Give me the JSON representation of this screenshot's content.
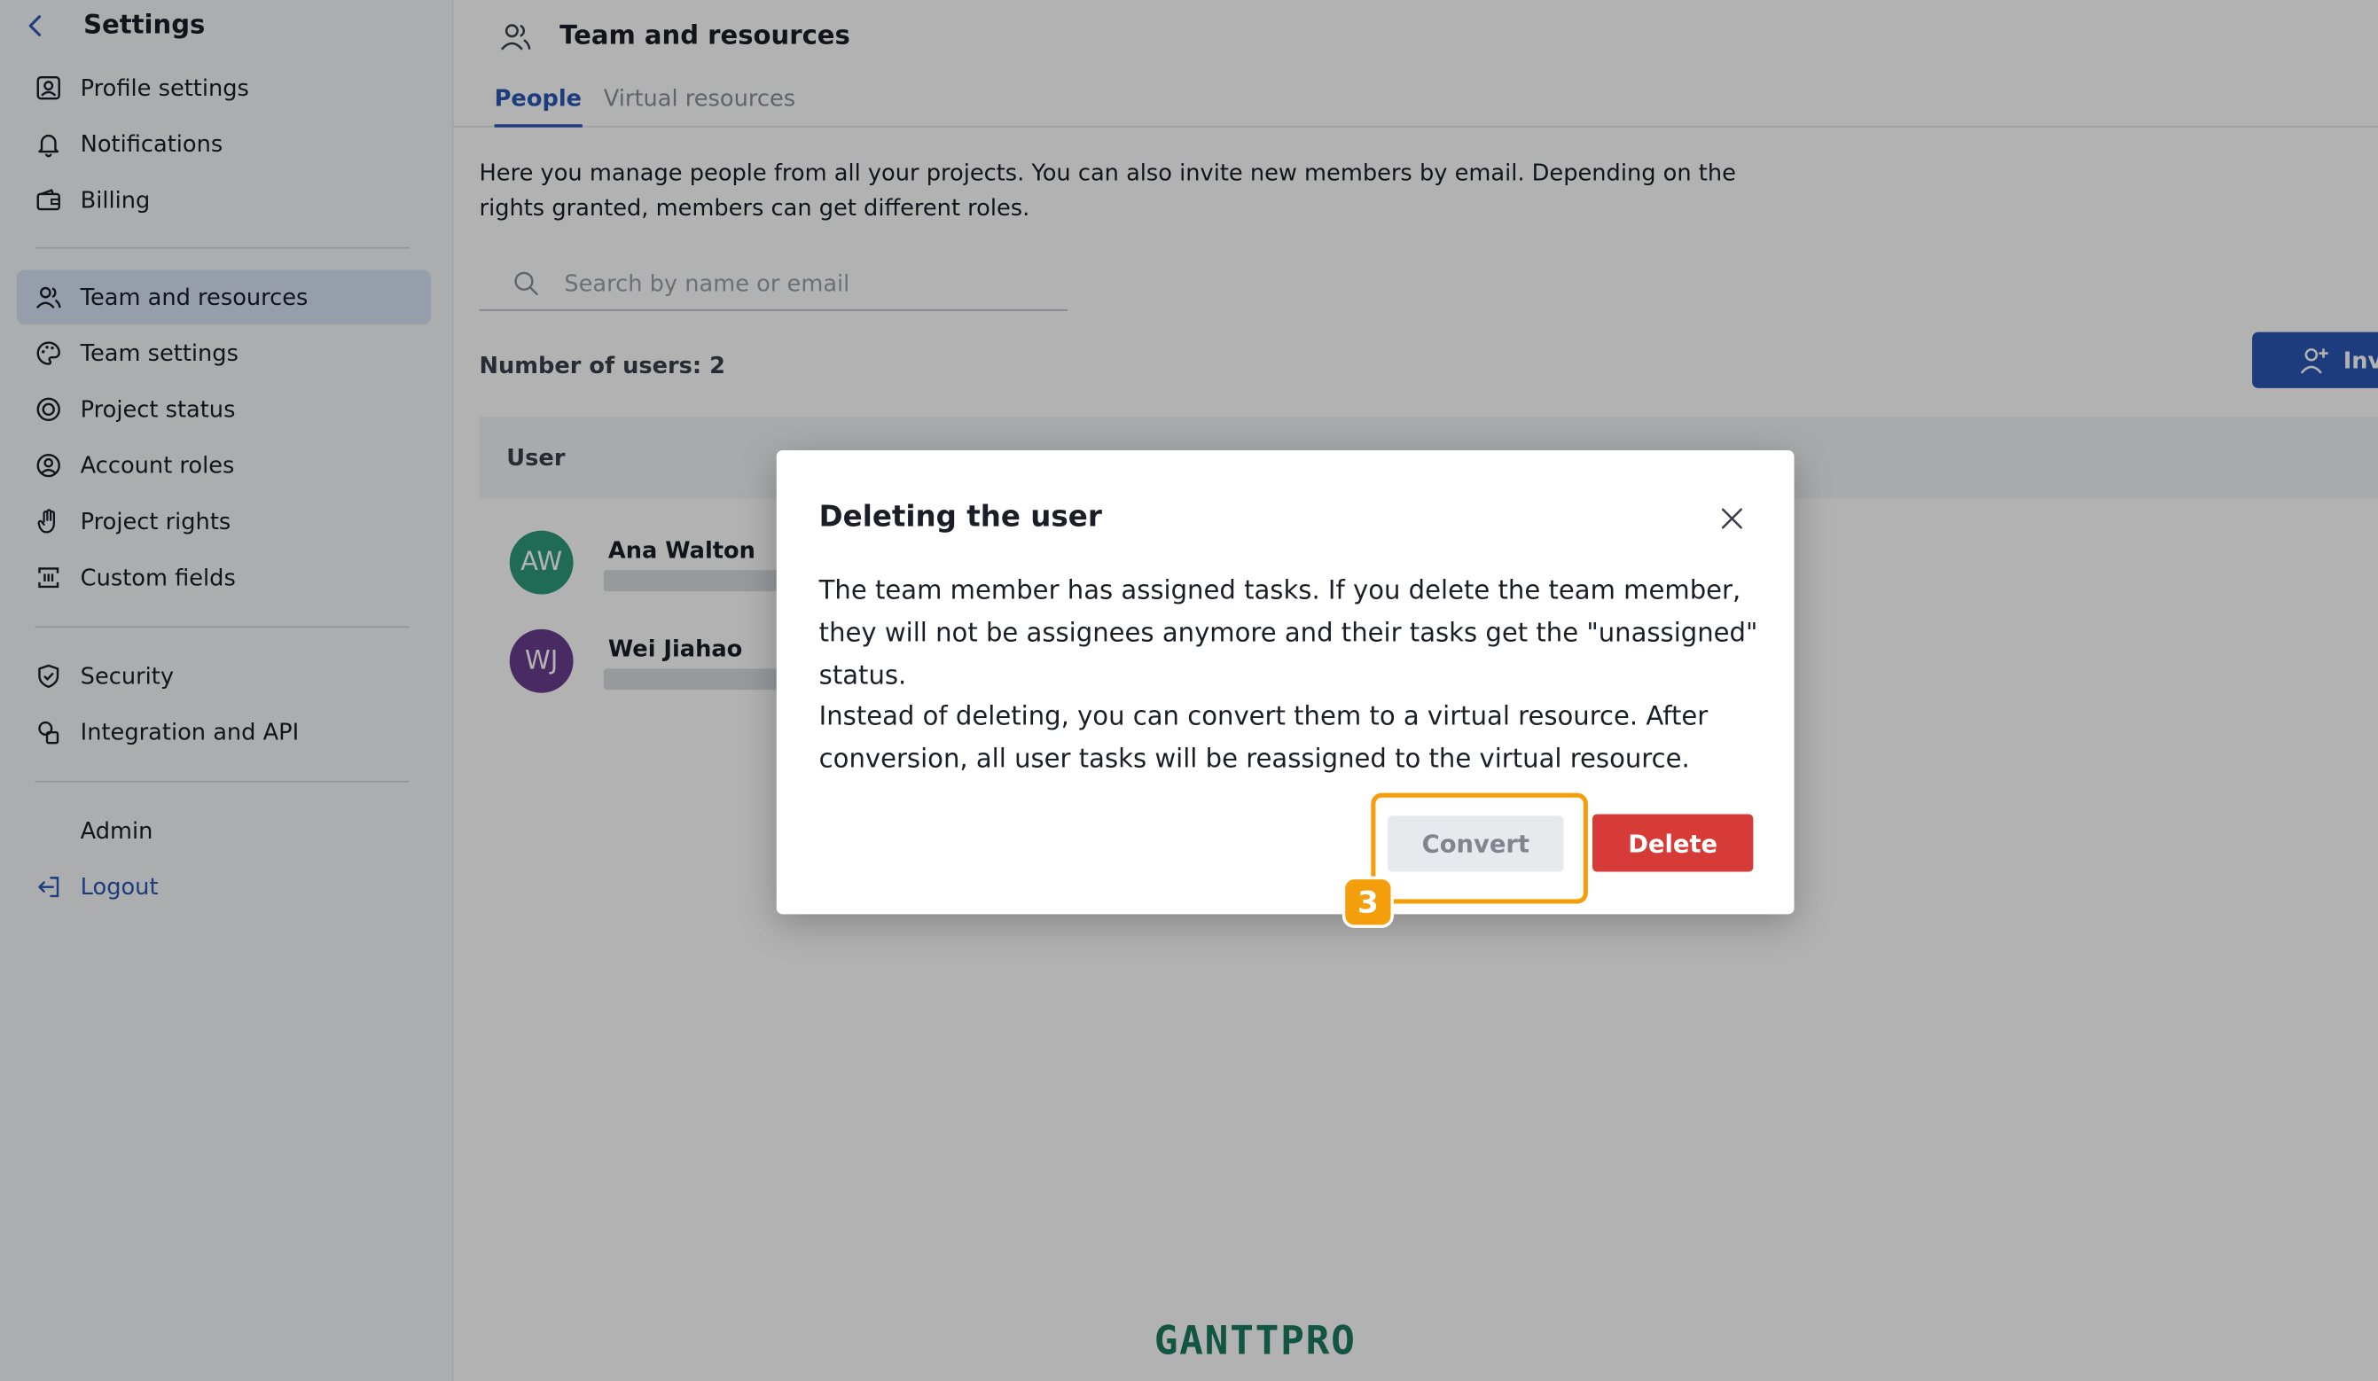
{
  "sidebar": {
    "title": "Settings",
    "items": [
      {
        "label": "Profile settings",
        "icon": "profile-icon"
      },
      {
        "label": "Notifications",
        "icon": "bell-icon"
      },
      {
        "label": "Billing",
        "icon": "wallet-icon"
      },
      {
        "label": "Team and resources",
        "icon": "team-icon",
        "active": true
      },
      {
        "label": "Team settings",
        "icon": "palette-icon"
      },
      {
        "label": "Project status",
        "icon": "status-icon"
      },
      {
        "label": "Account roles",
        "icon": "user-circle-icon"
      },
      {
        "label": "Project rights",
        "icon": "hand-icon"
      },
      {
        "label": "Custom fields",
        "icon": "custom-fields-icon"
      },
      {
        "label": "Security",
        "icon": "shield-icon"
      },
      {
        "label": "Integration and API",
        "icon": "integration-icon"
      },
      {
        "label": "Admin",
        "icon": ""
      },
      {
        "label": "Logout",
        "icon": "logout-icon"
      }
    ]
  },
  "header": {
    "title": "Team and resources"
  },
  "tabs": [
    {
      "label": "People",
      "active": true
    },
    {
      "label": "Virtual resources",
      "active": false
    }
  ],
  "description": "Here you manage people from all your projects. You can also invite new members by email. Depending on the rights granted, members can get different roles.",
  "search": {
    "placeholder": "Search by name or email",
    "value": ""
  },
  "users_count": "Number of users: 2",
  "invite_button": "Inv",
  "table": {
    "columns": [
      "User"
    ],
    "rows": [
      {
        "initials": "AW",
        "name": "Ana Walton",
        "avatar_color": "#2e9a78"
      },
      {
        "initials": "WJ",
        "name": "Wei Jiahao",
        "avatar_color": "#6a3d8e"
      }
    ]
  },
  "modal": {
    "title": "Deleting the user",
    "paragraph1": "The team member has assigned tasks. If you delete the team member, they will not be assignees anymore and their tasks get the \"unassigned\" status.",
    "paragraph2": "Instead of deleting, you can convert them to a virtual resource. After conversion, all user tasks will be reassigned to the virtual resource.",
    "convert_label": "Convert",
    "delete_label": "Delete"
  },
  "step_badge": "3",
  "brand": "GANTTPRO",
  "colors": {
    "accent": "#2a56b3",
    "danger": "#d63b37",
    "highlight": "#f59e0b",
    "brand": "#1a7a5c"
  }
}
